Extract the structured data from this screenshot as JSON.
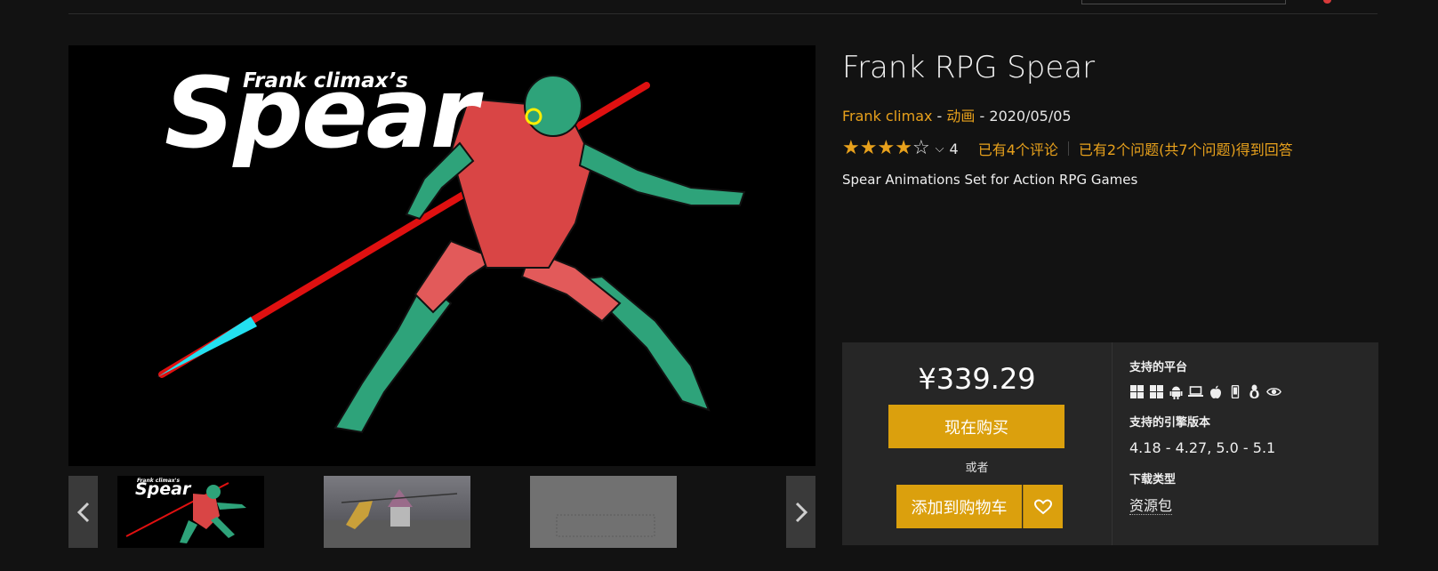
{
  "product": {
    "title": "Frank RPG Spear",
    "author": "Frank climax",
    "category": "动画",
    "date": "2020/05/05",
    "rating_value": 4,
    "rating_count": "4",
    "reviews_link": "已有4个评论",
    "questions_link": "已有2个问题(共7个问题)得到回答",
    "description": "Spear Animations Set for Action RPG Games"
  },
  "hero": {
    "subtitle": "Frank climax’s",
    "title": "Spear"
  },
  "thumbnails": [
    {
      "sub": "Frank climax's",
      "title": "Spear"
    },
    {},
    {}
  ],
  "purchase": {
    "price": "¥339.29",
    "buy_label": "现在购买",
    "or_label": "或者",
    "cart_label": "添加到购物车"
  },
  "details": {
    "platforms_label": "支持的平台",
    "platform_icons": [
      "windows-icon",
      "windows-icon",
      "android-icon",
      "laptop-icon",
      "apple-icon",
      "phone-icon",
      "linux-icon",
      "eye-icon"
    ],
    "engine_label": "支持的引擎版本",
    "engine_versions": "4.18 - 4.27, 5.0 - 5.1",
    "download_label": "下载类型",
    "download_type": "资源包"
  },
  "colors": {
    "accent": "#e8a11c",
    "button": "#dba00d",
    "background": "#121212",
    "panel": "#262626"
  }
}
